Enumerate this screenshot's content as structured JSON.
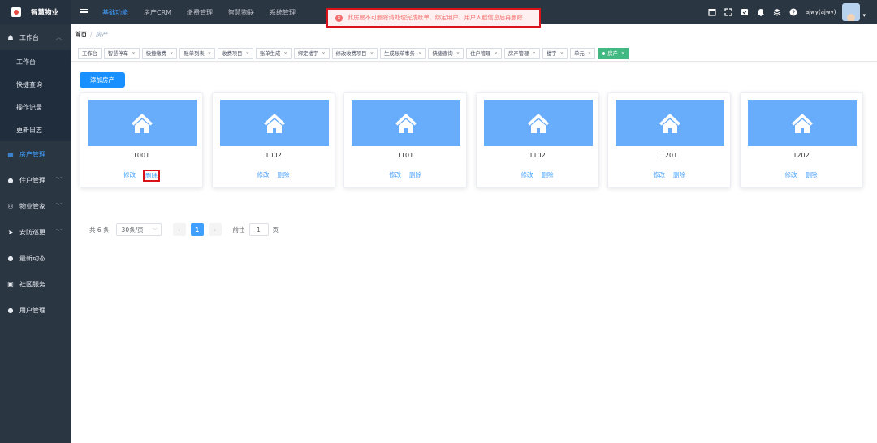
{
  "app": {
    "title": "智慧物业"
  },
  "topnav": {
    "items": [
      "基础功能",
      "房产CRM",
      "缴费管理",
      "智慧物联",
      "系统管理"
    ],
    "active_index": 0
  },
  "user": {
    "name": "ajwy(ajwy)"
  },
  "alert": {
    "message": "此房屋不可删除请处理完成账单、绑定用户、用户人脸信息后再删除"
  },
  "sidebar": {
    "workbench": {
      "label": "工作台",
      "children": [
        "工作台",
        "快捷查询",
        "操作记录",
        "更新日志"
      ]
    },
    "items": [
      {
        "label": "房产管理",
        "active": true,
        "chevron": false
      },
      {
        "label": "住户管理",
        "chevron": true
      },
      {
        "label": "物业管家",
        "chevron": true
      },
      {
        "label": "安防巡更",
        "chevron": true
      },
      {
        "label": "最新动态",
        "chevron": false
      },
      {
        "label": "社区服务",
        "chevron": false
      },
      {
        "label": "用户管理",
        "chevron": false
      }
    ]
  },
  "breadcrumb": {
    "home": "首页",
    "sep": "/",
    "current": "房产"
  },
  "tags": [
    "工作台",
    "智慧停车",
    "快捷缴费",
    "账单列表",
    "收费项目",
    "账单生成",
    "绑定楼宇",
    "修改收费项目",
    "生成账单事务",
    "快捷查询",
    "住户管理",
    "房产管理",
    "楼宇",
    "单元",
    "房产"
  ],
  "toolbar": {
    "add_label": "添加房产"
  },
  "cards": [
    {
      "name": "1001",
      "edit": "修改",
      "del": "删除"
    },
    {
      "name": "1002",
      "edit": "修改",
      "del": "删除"
    },
    {
      "name": "1101",
      "edit": "修改",
      "del": "删除"
    },
    {
      "name": "1102",
      "edit": "修改",
      "del": "删除"
    },
    {
      "name": "1201",
      "edit": "修改",
      "del": "删除"
    },
    {
      "name": "1202",
      "edit": "修改",
      "del": "删除"
    }
  ],
  "pager": {
    "total": "共 6 条",
    "size": "30条/页",
    "current": "1",
    "goto": "前往",
    "goto_value": "1",
    "unit": "页"
  }
}
